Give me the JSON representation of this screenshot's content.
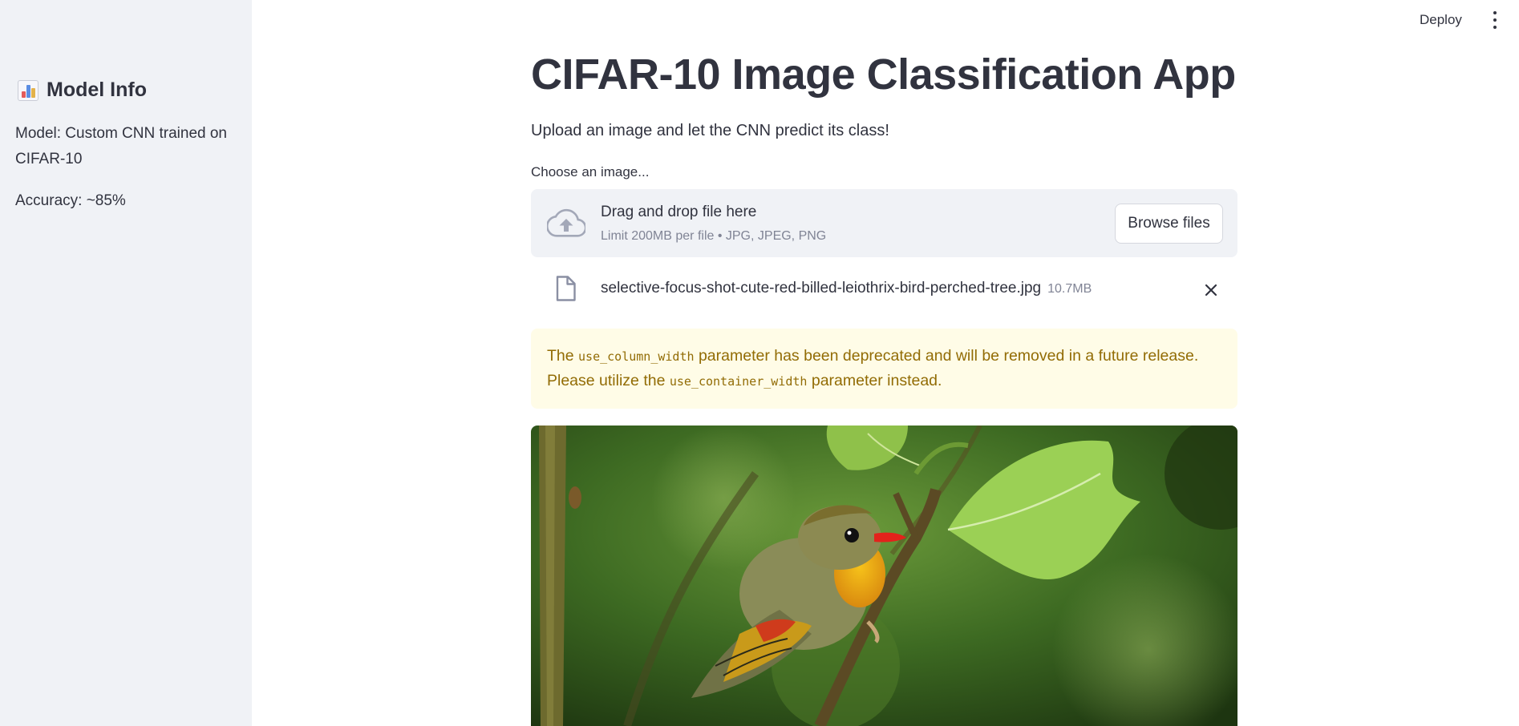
{
  "header": {
    "deploy_label": "Deploy",
    "menu_icon": "kebab-menu-icon"
  },
  "sidebar": {
    "title": "Model Info",
    "title_icon": "bar-chart-emoji-icon",
    "model_text": "Model: Custom CNN trained on CIFAR-10",
    "accuracy_text": "Accuracy: ~85%"
  },
  "main": {
    "title": "CIFAR-10 Image Classification App",
    "subtitle": "Upload an image and let the CNN predict its class!",
    "uploader": {
      "label": "Choose an image...",
      "drop_title": "Drag and drop file here",
      "limit_text": "Limit 200MB per file • JPG, JPEG, PNG",
      "browse_label": "Browse files",
      "upload_icon": "cloud-upload-icon"
    },
    "uploaded_file": {
      "name": "selective-focus-shot-cute-red-billed-leiothrix-bird-perched-tree.jpg",
      "size": "10.7MB",
      "file_icon": "file-icon",
      "remove_icon": "close-icon"
    },
    "warning": {
      "text_1": "The ",
      "code_1": "use_column_width",
      "text_2": " parameter has been deprecated and will be removed in a future release. Please utilize the ",
      "code_2": "use_container_width",
      "text_3": " parameter instead."
    }
  },
  "colors": {
    "sidebar_bg": "#f0f2f6",
    "text": "#31333f",
    "muted": "#808495",
    "warning_bg": "#fffce7",
    "warning_text": "#926c05"
  }
}
